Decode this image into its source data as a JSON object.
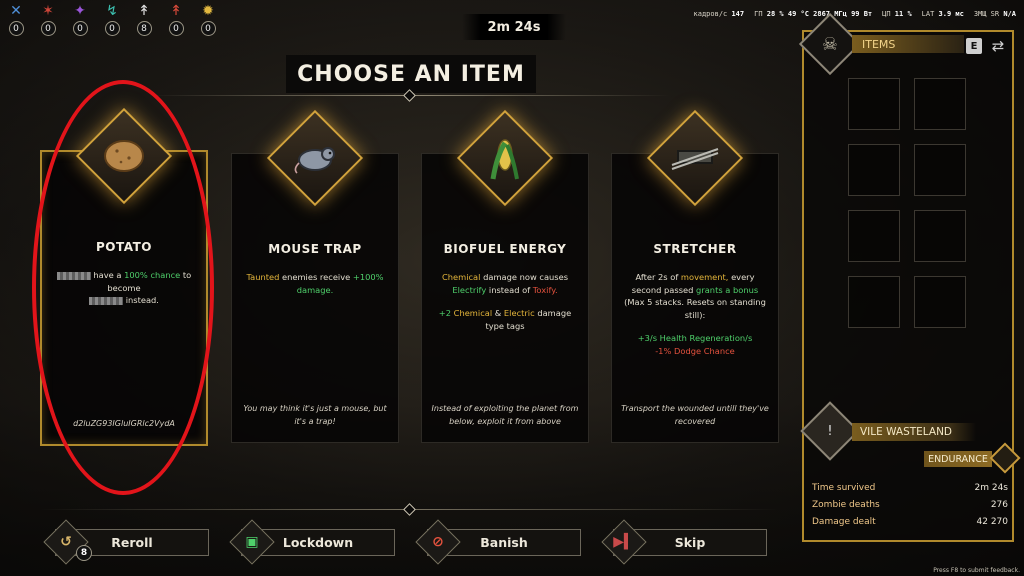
{
  "hud": {
    "counters": [
      {
        "icon": "blue-rune-icon",
        "glyph": "✕",
        "color": "#4f8fd8",
        "count": "0"
      },
      {
        "icon": "red-rune-icon",
        "glyph": "✶",
        "color": "#d0463a",
        "count": "0"
      },
      {
        "icon": "purple-rune-icon",
        "glyph": "✦",
        "color": "#9a55d8",
        "count": "0"
      },
      {
        "icon": "teal-rune-icon",
        "glyph": "↯",
        "color": "#3cc0b0",
        "count": "0"
      },
      {
        "icon": "white-blade-icon",
        "glyph": "↟",
        "color": "#e0e0e0",
        "count": "8"
      },
      {
        "icon": "red-blade-icon",
        "glyph": "↟",
        "color": "#d84a3a",
        "count": "0"
      },
      {
        "icon": "gold-sun-icon",
        "glyph": "✹",
        "color": "#e2b840",
        "count": "0"
      }
    ],
    "timer": "2m 24s",
    "perf": {
      "fps_label": "кадров/с",
      "fps": "147",
      "gpu_label": "ГП",
      "gpu": "28 % 49 °C 2867 МГц 99 Вт",
      "cpu_label": "ЦП",
      "cpu": "11 %",
      "lat_label": "LAT",
      "lat": "3.9 мс",
      "sr_label": "ЗМЩ SR",
      "sr": "N/A"
    }
  },
  "title": "CHOOSE AN ITEM",
  "cards": [
    {
      "name": "POTATO",
      "icon": "potato-icon",
      "desc_prefix": "have a",
      "desc_chance": "100% chance",
      "desc_mid": "to become",
      "desc_suffix": "instead.",
      "flavor": "d2luZG93IGluIGRlc2VydA"
    },
    {
      "name": "MOUSE TRAP",
      "icon": "rat-icon",
      "desc_a": "Taunted",
      "desc_b": "enemies receive",
      "desc_c": "+100% damage.",
      "flavor": "You may think it's just a mouse, but it's a trap!"
    },
    {
      "name": "BIOFUEL ENERGY",
      "icon": "corn-icon",
      "desc_a": "Chemical",
      "desc_b": "damage now causes",
      "desc_c": "Electrify",
      "desc_d": "instead of",
      "desc_e": "Toxify.",
      "tags_a": "+2",
      "tags_b": "Chemical",
      "tags_c": "&",
      "tags_d": "Electric",
      "tags_e": "damage type tags",
      "flavor": "Instead of exploiting the planet from below, exploit it from above"
    },
    {
      "name": "STRETCHER",
      "icon": "stretcher-icon",
      "desc_a": "After 2s of",
      "desc_b": "movement,",
      "desc_c": "every second passed",
      "desc_d": "grants a bonus",
      "desc_e": "(Max 5 stacks. Resets on standing still):",
      "bonus_a": "+3/s Health Regeneration/s",
      "bonus_b": "-1% Dodge Chance",
      "flavor": "Transport the wounded untill they've recovered"
    }
  ],
  "buttons": [
    {
      "label": "Reroll",
      "icon": "reroll-icon",
      "glyph": "↺",
      "color": "#d7b56a",
      "badge": "8"
    },
    {
      "label": "Lockdown",
      "icon": "lock-icon",
      "glyph": "🔒",
      "color": "#4fd06b"
    },
    {
      "label": "Banish",
      "icon": "banish-icon",
      "glyph": "⊘",
      "color": "#e5523e"
    },
    {
      "label": "Skip",
      "icon": "skip-icon",
      "glyph": "⏭",
      "color": "#c94a4a"
    }
  ],
  "panel": {
    "items_title": "ITEMS",
    "key_hint": "E",
    "map_name": "VILE WASTELAND",
    "difficulty": "ENDURANCE",
    "stats": [
      {
        "label": "Time survived",
        "value": "2m 24s"
      },
      {
        "label": "Zombie deaths",
        "value": "276"
      },
      {
        "label": "Damage dealt",
        "value": "42 270"
      }
    ]
  },
  "feedback": "Press F8 to submit feedback."
}
